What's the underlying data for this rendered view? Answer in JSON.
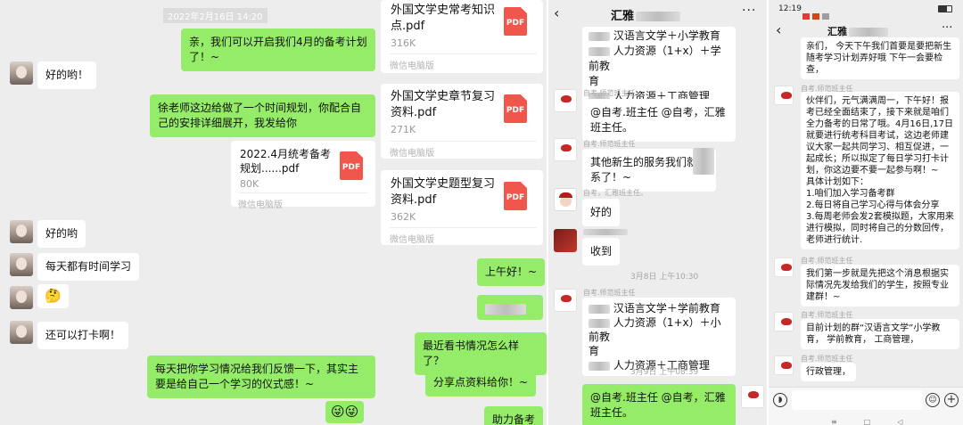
{
  "left": {
    "timestamp": "2022年2月16日 14:20",
    "messages": [
      "亲，我们可以开启我们4月的备考计划了！~",
      "好的哟！",
      "徐老师这边给做了一个时间规划，你配合自己的安排详细展开，我发给你",
      "好的哟",
      "每天都有时间学习",
      "🤔",
      "还可以打卡啊！",
      "每天把你学习情况给我们反馈一下，其实主要是给自己一个学习的仪式感！~",
      "😜😜"
    ],
    "file": {
      "name": "2022.4月统考备考规划......pdf",
      "size": "80K",
      "source": "微信电脑版",
      "icon": "PDF"
    }
  },
  "middle": {
    "files": [
      {
        "name": "外国文学史常考知识点.pdf",
        "size": "316K",
        "source": "微信电脑版",
        "icon": "PDF"
      },
      {
        "name": "外国文学史章节复习资料.pdf",
        "size": "271K",
        "source": "微信电脑版",
        "icon": "PDF"
      },
      {
        "name": "外国文学史题型复习资料.pdf",
        "size": "362K",
        "source": "微信电脑版",
        "icon": "PDF"
      }
    ],
    "messages": [
      "上午好！~",
      "最近看书情况怎么样了？",
      "分享点资料给你！~",
      "助力备考"
    ]
  },
  "third": {
    "title": "汇雅",
    "lines_a": [
      "汉语言文学＋小学教育",
      "人力资源（1+x）＋学前教",
      "育",
      "人力资源＋工商管理"
    ],
    "sender1": "自考.师范班主任",
    "msg1": "@自考.班主任 @自考，汇雅班主任。",
    "sender2": "自考.师范班主任",
    "msg2_a": "其他新生的服务我们就",
    "msg2_b": "系了！~",
    "sender3": "自考，汇雅班主任。",
    "msg3": "好的",
    "msg4": "收到",
    "time1": "3月8日 上午10:30",
    "sender4": "自考.师范班主任",
    "lines_b": [
      "汉语言文学＋学前教育",
      "人力资源（1+x）＋小前教",
      "育",
      "人力资源＋工商管理"
    ],
    "time2": "3月9日 上午08:39",
    "msg5": "@自考.班主任 @自考，汇雅班主任。"
  },
  "right": {
    "status_time": "12:19",
    "title": "汇雅",
    "msg0": "亲们，   今天下午我们首要是要把新生随考学习计划弄好哦   下午一会要检查，",
    "sender1": "自考.师范班主任",
    "msg1": "伙伴们，元气满满周一，下午好！报考已经全面结束了，接下来就是咱们全力备考的日常了哦。4月16日,17日就要进行统考科目考试，这边老师建议大家一起共同学习、相互促进，一起成长；所以拟定了每日学习打卡计划，你这边要不要一起参与啊！~\n具体计划如下：\n1.咱们加入学习备考群\n2.每日将自己学习心得与体会分享\n3.每周老师会发2套模拟题，大家用来进行模拟，同时将自己的分数回传，老师进行统计.",
    "sender2": "自考.师范班主任",
    "msg2": "我们第一步就是先把这个消息根据实际情况先发给我们的学生，按照专业建群！~",
    "sender3": "自考.师范班主任",
    "msg3": "目前计划的群“汉语言文学”小学教育，  学前教育，  工商管理，",
    "sender4": "自考.师范班主任",
    "msg4": "行政管理，"
  }
}
